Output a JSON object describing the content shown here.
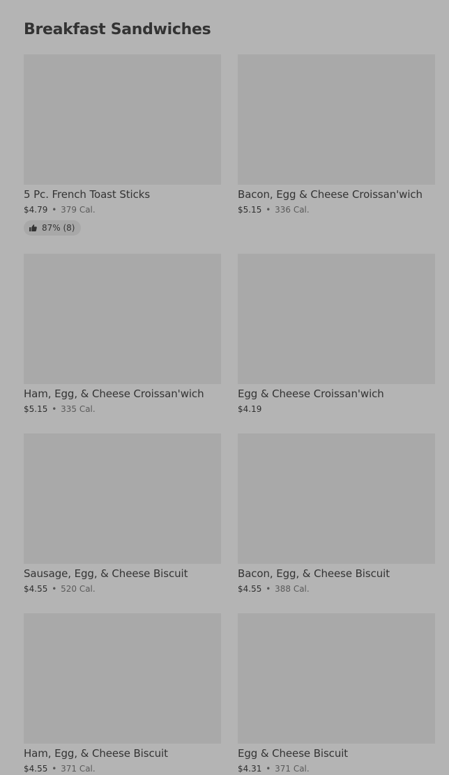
{
  "section": {
    "title": "Breakfast Sandwiches"
  },
  "items": [
    {
      "name": "5 Pc. French Toast Sticks",
      "price": "$4.79",
      "separator": "•",
      "calories": "379 Cal.",
      "rating": "87% (8)"
    },
    {
      "name": "Bacon, Egg & Cheese Croissan'wich",
      "price": "$5.15",
      "separator": "•",
      "calories": "336 Cal."
    },
    {
      "name": "Ham, Egg, & Cheese Croissan'wich",
      "price": "$5.15",
      "separator": "•",
      "calories": "335 Cal."
    },
    {
      "name": "Egg & Cheese Croissan'wich",
      "price": "$4.19"
    },
    {
      "name": "Sausage, Egg, & Cheese Biscuit",
      "price": "$4.55",
      "separator": "•",
      "calories": "520 Cal."
    },
    {
      "name": "Bacon, Egg, & Cheese Biscuit",
      "price": "$4.55",
      "separator": "•",
      "calories": "388 Cal."
    },
    {
      "name": "Ham, Egg, & Cheese Biscuit",
      "price": "$4.55",
      "separator": "•",
      "calories": "371 Cal."
    },
    {
      "name": "Egg & Cheese Biscuit",
      "price": "$4.31",
      "separator": "•",
      "calories": "371 Cal."
    }
  ],
  "icons": {
    "rating": "thumbs-up-icon"
  },
  "colors": {
    "background": "#b4b4b4",
    "image_placeholder": "#a9a9a9",
    "text": "#333333"
  }
}
